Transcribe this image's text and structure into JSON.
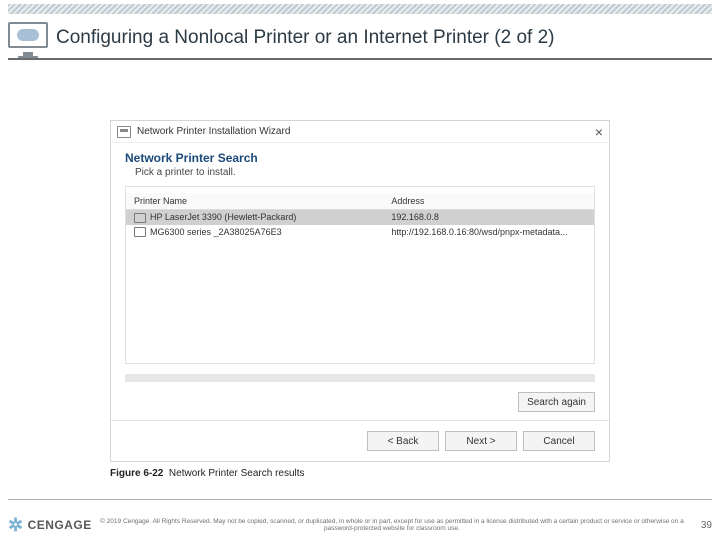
{
  "slide": {
    "title": "Configuring a Nonlocal Printer or an Internet Printer (2 of 2)",
    "number": "39"
  },
  "dialog": {
    "title": "Network Printer Installation Wizard",
    "heading": "Network Printer Search",
    "subheading": "Pick a printer to install.",
    "columns": {
      "name": "Printer Name",
      "address": "Address"
    },
    "rows": [
      {
        "name": "HP LaserJet 3390 (Hewlett-Packard)",
        "address": "192.168.0.8",
        "selected": true
      },
      {
        "name": "MG6300 series _2A38025A76E3",
        "address": "http://192.168.0.16:80/wsd/pnpx-metadata...",
        "selected": false
      }
    ],
    "buttons": {
      "search_again": "Search again",
      "back": "< Back",
      "next": "Next >",
      "cancel": "Cancel"
    }
  },
  "figure": {
    "label": "Figure 6-22",
    "caption": "Network Printer Search results"
  },
  "footer": {
    "brand": "CENGAGE",
    "copyright": "© 2019 Cengage. All Rights Reserved. May not be copied, scanned, or duplicated, in whole or in part, except for use as permitted in a license distributed with a certain product or service or otherwise on a password-protected website for classroom use."
  }
}
